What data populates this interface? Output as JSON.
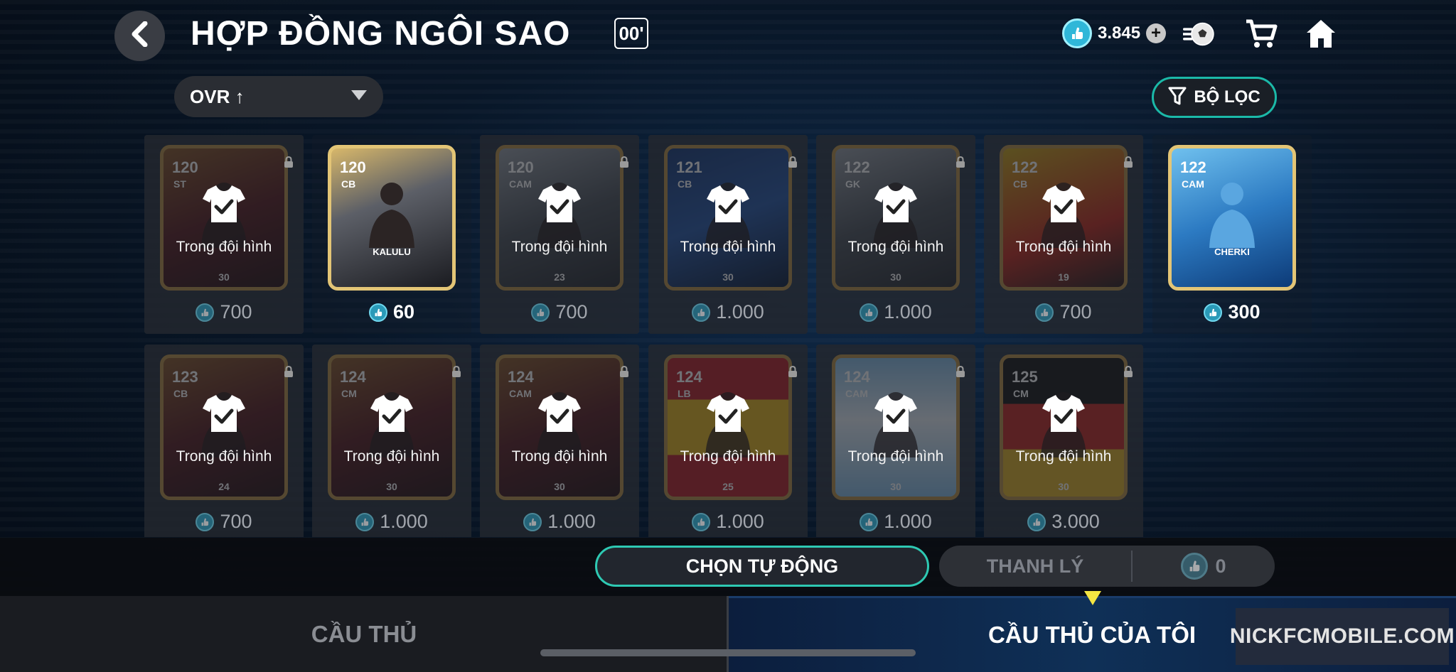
{
  "header": {
    "title": "HỢP ĐỒNG NGÔI SAO",
    "title_badge": "00'",
    "currency_value": "3.845",
    "icons": [
      "back-icon",
      "coin-icon",
      "plus-icon",
      "ball-icon",
      "cart-icon",
      "home-icon"
    ]
  },
  "sort": {
    "label": "OVR ↑"
  },
  "filter": {
    "label": "BỘ LỌC"
  },
  "squad_label": "Trong đội hình",
  "slots": [
    {
      "ovr": "120",
      "pos": "ST",
      "lvl": "30",
      "price": "700",
      "in_squad": true,
      "style": "red"
    },
    {
      "ovr": "120",
      "pos": "CB",
      "name": "KALULU",
      "price": "60",
      "in_squad": false,
      "style": "kalulu"
    },
    {
      "ovr": "120",
      "pos": "CAM",
      "lvl": "23",
      "price": "700",
      "in_squad": true,
      "style": "grey"
    },
    {
      "ovr": "121",
      "pos": "CB",
      "lvl": "30",
      "price": "1.000",
      "in_squad": true,
      "style": "blue"
    },
    {
      "ovr": "122",
      "pos": "GK",
      "lvl": "30",
      "price": "1.000",
      "in_squad": true,
      "style": "grey"
    },
    {
      "ovr": "122",
      "pos": "CB",
      "lvl": "19",
      "price": "700",
      "in_squad": true,
      "style": "yellow"
    },
    {
      "ovr": "122",
      "pos": "CAM",
      "name": "CHERKI",
      "price": "300",
      "in_squad": false,
      "style": "cherki"
    },
    {
      "ovr": "123",
      "pos": "CB",
      "lvl": "24",
      "price": "700",
      "in_squad": true,
      "style": "red"
    },
    {
      "ovr": "124",
      "pos": "CM",
      "lvl": "30",
      "price": "1.000",
      "in_squad": true,
      "style": "red"
    },
    {
      "ovr": "124",
      "pos": "CAM",
      "lvl": "30",
      "price": "1.000",
      "in_squad": true,
      "style": "red"
    },
    {
      "ovr": "124",
      "pos": "LB",
      "lvl": "25",
      "price": "1.000",
      "in_squad": true,
      "style": "spain"
    },
    {
      "ovr": "124",
      "pos": "CAM",
      "lvl": "30",
      "price": "1.000",
      "in_squad": true,
      "style": "argentina"
    },
    {
      "ovr": "125",
      "pos": "CM",
      "lvl": "30",
      "price": "3.000",
      "in_squad": true,
      "style": "germany"
    }
  ],
  "actions": {
    "auto_select": "CHỌN TỰ ĐỘNG",
    "sell": "THANH LÝ",
    "sell_count": "0"
  },
  "tabs": {
    "players": "CẦU THỦ",
    "my_players": "CẦU THỦ CỦA TÔI"
  },
  "watermark": "NICKFCMOBILE.COM",
  "colors": {
    "accent_teal": "#2ec9b3",
    "coin_blue": "#2fb7d8",
    "active_arrow": "#f5e642"
  }
}
